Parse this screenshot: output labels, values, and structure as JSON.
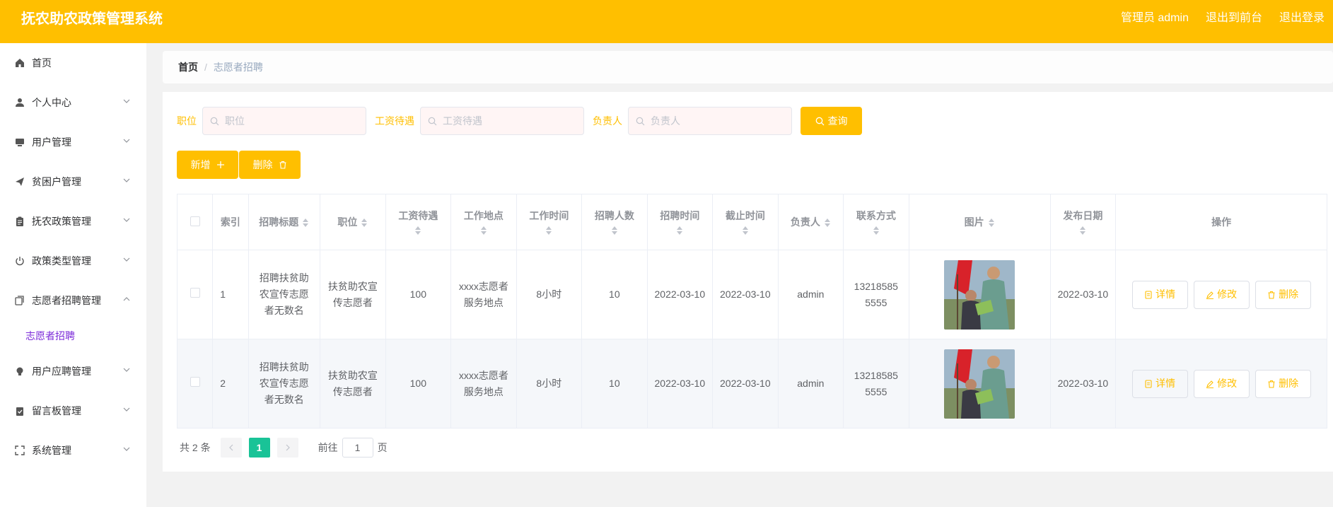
{
  "header": {
    "title": "抚农助农政策管理系统",
    "admin_label": "管理员 admin",
    "front_link": "退出到前台",
    "logout_link": "退出登录"
  },
  "sidebar": {
    "items": [
      {
        "label": "首页",
        "icon": "home-icon"
      },
      {
        "label": "个人中心",
        "icon": "user-icon"
      },
      {
        "label": "用户管理",
        "icon": "monitor-icon"
      },
      {
        "label": "贫困户管理",
        "icon": "send-icon"
      },
      {
        "label": "抚农政策管理",
        "icon": "clipboard-icon"
      },
      {
        "label": "政策类型管理",
        "icon": "power-icon"
      },
      {
        "label": "志愿者招聘管理",
        "icon": "copy-icon"
      },
      {
        "label": "用户应聘管理",
        "icon": "bulb-icon"
      },
      {
        "label": "留言板管理",
        "icon": "checklist-icon"
      },
      {
        "label": "系统管理",
        "icon": "fullscreen-icon"
      }
    ],
    "sub_item": "志愿者招聘"
  },
  "breadcrumb": {
    "home": "首页",
    "sep": "/",
    "current": "志愿者招聘"
  },
  "search": {
    "position_label": "职位",
    "position_placeholder": "职位",
    "salary_label": "工资待遇",
    "salary_placeholder": "工资待遇",
    "owner_label": "负责人",
    "owner_placeholder": "负责人",
    "query_button": "查询"
  },
  "actions": {
    "add": "新增",
    "delete": "删除"
  },
  "table": {
    "headers": [
      "索引",
      "招聘标题",
      "职位",
      "工资待遇",
      "工作地点",
      "工作时间",
      "招聘人数",
      "招聘时间",
      "截止时间",
      "负责人",
      "联系方式",
      "图片",
      "发布日期",
      "操作"
    ],
    "rows": [
      {
        "index": "1",
        "title": "招聘扶贫助农宣传志愿者无数名",
        "position": "扶贫助农宣传志愿者",
        "salary": "100",
        "location": "xxxx志愿者服务地点",
        "hours": "8小时",
        "count": "10",
        "start": "2022-03-10",
        "end": "2022-03-10",
        "owner": "admin",
        "phone": "13218585 5555",
        "date": "2022-03-10"
      },
      {
        "index": "2",
        "title": "招聘扶贫助农宣传志愿者无数名",
        "position": "扶贫助农宣传志愿者",
        "salary": "100",
        "location": "xxxx志愿者服务地点",
        "hours": "8小时",
        "count": "10",
        "start": "2022-03-10",
        "end": "2022-03-10",
        "owner": "admin",
        "phone": "13218585 5555",
        "date": "2022-03-10"
      }
    ],
    "row_buttons": {
      "detail": "详情",
      "edit": "修改",
      "delete": "删除"
    }
  },
  "pagination": {
    "total": "共 2 条",
    "current_page": "1",
    "goto_label": "前往",
    "goto_value": "1",
    "page_unit": "页"
  },
  "colors": {
    "primary": "#ffbf00",
    "active_page": "#19c397",
    "sub_active": "#7c2bd9"
  }
}
